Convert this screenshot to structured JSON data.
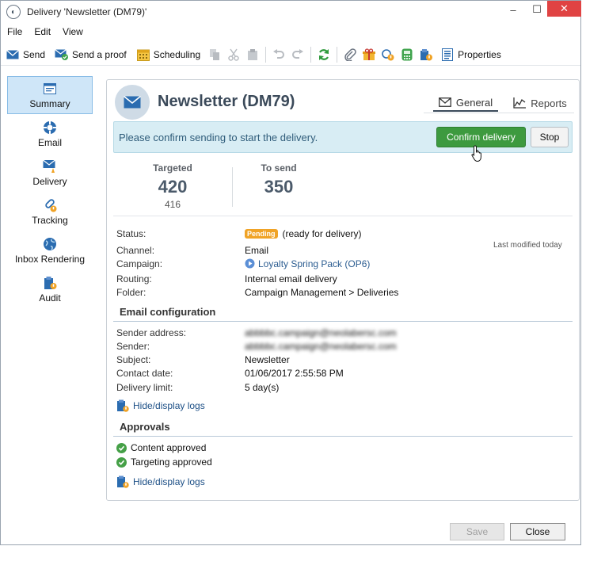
{
  "window": {
    "title": "Delivery 'Newsletter (DM79)'",
    "controls": {
      "minimize": "–",
      "maximize": "☐",
      "close": "✕"
    }
  },
  "menu": [
    "File",
    "Edit",
    "View"
  ],
  "toolbar": {
    "send_label": "Send",
    "proof_label": "Send a proof",
    "scheduling_label": "Scheduling",
    "properties_label": "Properties"
  },
  "sidebar": {
    "items": [
      {
        "label": "Summary",
        "icon": "summary-icon"
      },
      {
        "label": "Email",
        "icon": "email-icon"
      },
      {
        "label": "Delivery",
        "icon": "delivery-icon"
      },
      {
        "label": "Tracking",
        "icon": "tracking-icon"
      },
      {
        "label": "Inbox Rendering",
        "icon": "globe-icon"
      },
      {
        "label": "Audit",
        "icon": "audit-icon"
      }
    ]
  },
  "header": {
    "title": "Newsletter (DM79)",
    "tabs": {
      "general": "General",
      "reports": "Reports"
    }
  },
  "confirm": {
    "message": "Please confirm sending to start the delivery.",
    "confirm_label": "Confirm delivery",
    "stop_label": "Stop"
  },
  "stats": {
    "targeted_label": "Targeted",
    "targeted_value": "420",
    "targeted_sub": "416",
    "tosend_label": "To send",
    "tosend_value": "350"
  },
  "details": {
    "status_label": "Status:",
    "status_badge": "Pending",
    "status_text": "(ready for delivery)",
    "last_modified": "Last modified today",
    "channel_label": "Channel:",
    "channel_value": "Email",
    "campaign_label": "Campaign:",
    "campaign_value": "Loyalty Spring Pack (OP6)",
    "routing_label": "Routing:",
    "routing_value": "Internal email delivery",
    "folder_label": "Folder:",
    "folder_value": "Campaign Management > Deliveries"
  },
  "email_config": {
    "title": "Email configuration",
    "sender_address_label": "Sender address:",
    "sender_address_value": "abbbbc.campaign@neolabersc.com",
    "sender_label": "Sender:",
    "sender_value": "abbbbc.campaign@neolabersc.com",
    "subject_label": "Subject:",
    "subject_value": "Newsletter",
    "contact_date_label": "Contact date:",
    "contact_date_value": "01/06/2017 2:55:58 PM",
    "delivery_limit_label": "Delivery limit:",
    "delivery_limit_value": "5 day(s)",
    "logs_link": "Hide/display logs"
  },
  "approvals": {
    "title": "Approvals",
    "content": "Content approved",
    "targeting": "Targeting approved",
    "logs_link": "Hide/display logs"
  },
  "footer": {
    "save_label": "Save",
    "close_label": "Close"
  },
  "colors": {
    "confirm_green": "#3d9a3f",
    "pending_orange": "#f0a326",
    "link_blue": "#1c4f86",
    "banner_bg": "#d8edf4"
  }
}
